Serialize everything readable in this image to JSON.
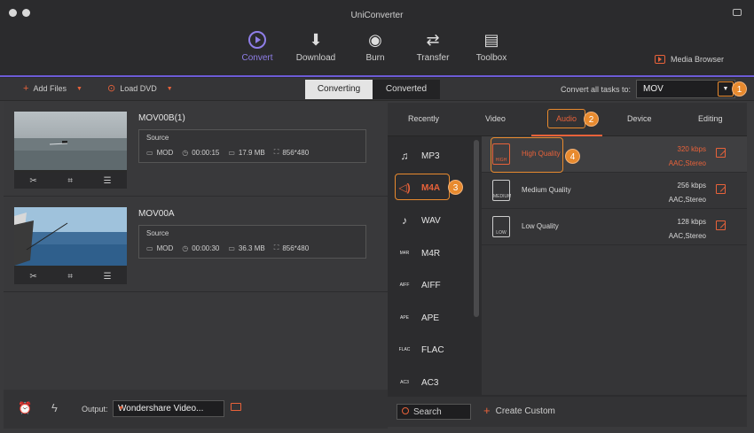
{
  "window": {
    "title": "UniConverter"
  },
  "nav": [
    {
      "label": "Convert",
      "active": true
    },
    {
      "label": "Download"
    },
    {
      "label": "Burn"
    },
    {
      "label": "Transfer"
    },
    {
      "label": "Toolbox"
    }
  ],
  "media_browser": "Media Browser",
  "toolbar": {
    "add_files": "Add Files",
    "load_dvd": "Load DVD",
    "tab_converting": "Converting",
    "tab_converted": "Converted",
    "convert_all_label": "Convert all tasks to:",
    "convert_all_value": "MOV"
  },
  "files": [
    {
      "name": "MOV00B(1)",
      "source_label": "Source",
      "format": "MOD",
      "duration": "00:00:15",
      "size": "17.9 MB",
      "resolution": "856*480"
    },
    {
      "name": "MOV00A",
      "source_label": "Source",
      "format": "MOD",
      "duration": "00:00:30",
      "size": "36.3 MB",
      "resolution": "856*480"
    }
  ],
  "bottom": {
    "output_label": "Output:",
    "output_value": "Wondershare Video..."
  },
  "panel": {
    "tabs": [
      "Recently",
      "Video",
      "Audio",
      "Device",
      "Editing"
    ],
    "active_tab": "Audio",
    "formats": [
      "MP3",
      "M4A",
      "WAV",
      "M4R",
      "AIFF",
      "APE",
      "FLAC",
      "AC3"
    ],
    "format_icon_labels": [
      "",
      "",
      "",
      "M4R",
      "AIFF",
      "APE",
      "FLAC",
      "AC3"
    ],
    "selected_format": "M4A",
    "qualities": [
      {
        "label": "High Quality",
        "rate": "320 kbps",
        "codec": "AAC,Stereo",
        "icon_text": "HIGH"
      },
      {
        "label": "Medium Quality",
        "rate": "256 kbps",
        "codec": "AAC,Stereo",
        "icon_text": "MEDIUM"
      },
      {
        "label": "Low Quality",
        "rate": "128 kbps",
        "codec": "AAC,Stereo",
        "icon_text": "LOW"
      }
    ],
    "search": "Search",
    "create_custom": "Create Custom"
  },
  "badges": [
    "1",
    "2",
    "3",
    "4"
  ],
  "colors": {
    "accent": "#e8623a",
    "nav_active": "#8f7ee8",
    "badge": "#e88a2e"
  }
}
